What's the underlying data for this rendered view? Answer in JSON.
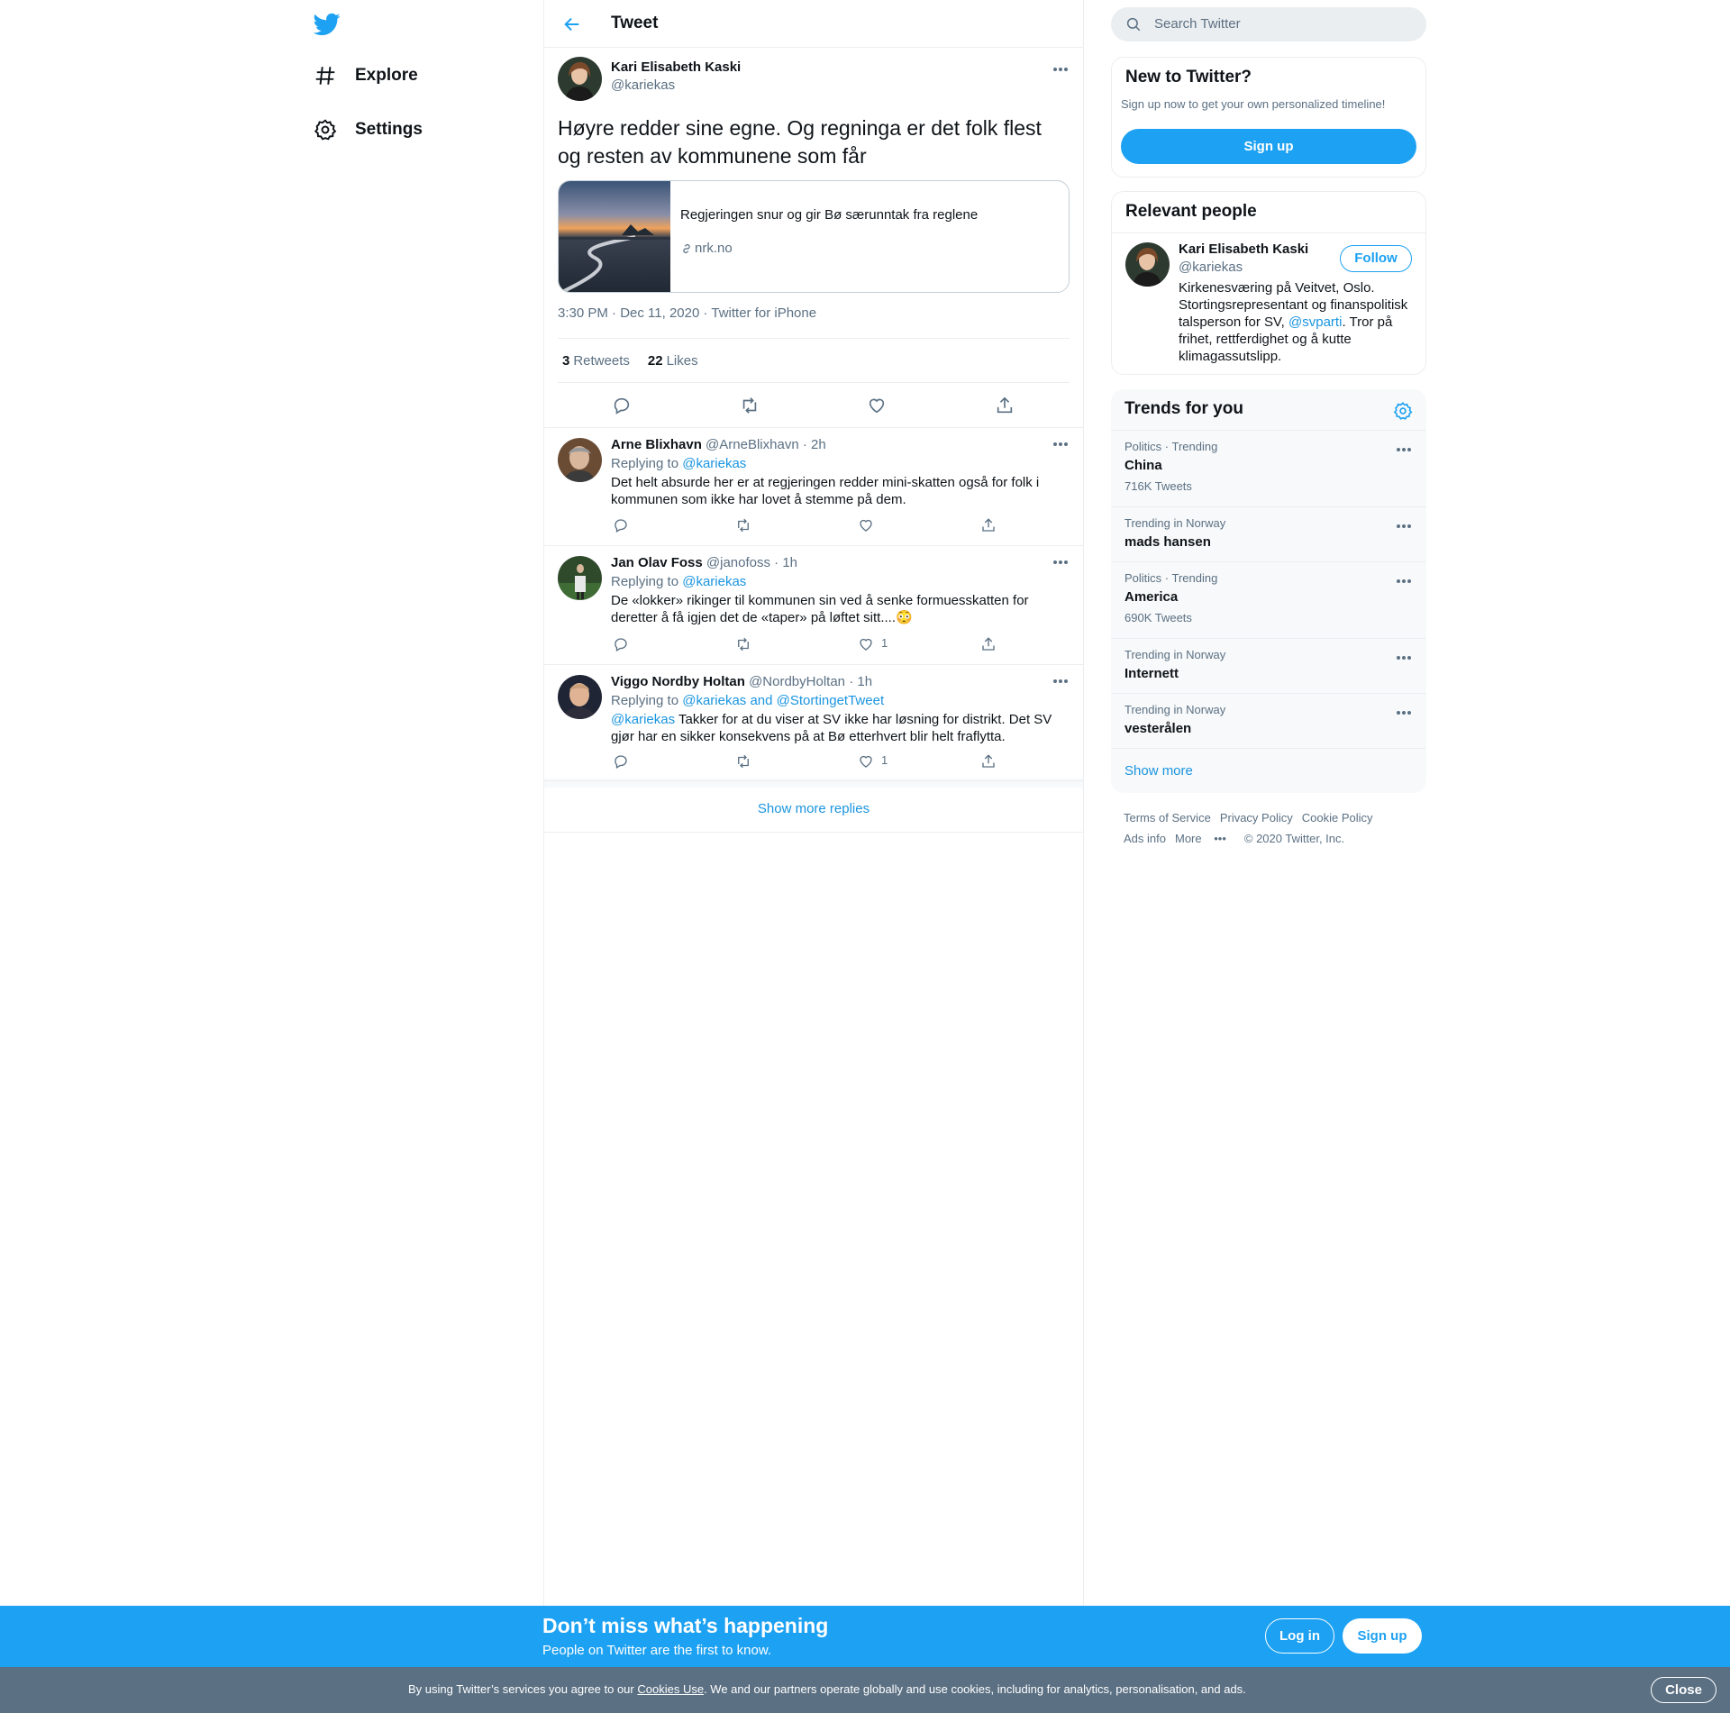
{
  "nav": {
    "logo_icon": "twitter-bird-icon",
    "items": [
      {
        "label": "Explore",
        "icon": "hashtag-icon"
      },
      {
        "label": "Settings",
        "icon": "gear-icon"
      }
    ]
  },
  "header": {
    "title": "Tweet",
    "back_icon": "back-arrow-icon"
  },
  "tweet": {
    "author_name": "Kari Elisabeth Kaski",
    "author_handle": "@kariekas",
    "text": "Høyre redder sine egne. Og regninga er det folk flest og resten av kommunene som får",
    "card": {
      "title": "Regjeringen snur og gir Bø særunntak fra reglene",
      "domain": "nrk.no"
    },
    "meta": "3:30 PM · Dec 11, 2020 · Twitter for iPhone",
    "retweets_count": "3",
    "retweets_label": "Retweets",
    "likes_count": "22",
    "likes_label": "Likes"
  },
  "replies": [
    {
      "name": "Arne Blixhavn",
      "handle": "@ArneBlixhavn",
      "time": "· 2h",
      "replying_prefix": "Replying to ",
      "replying_to": "@kariekas",
      "mention": "",
      "text": "Det helt absurde her er at regjeringen redder mini-skatten også for folk i kommunen som ikke har lovet å stemme på dem.",
      "likes": ""
    },
    {
      "name": "Jan Olav Foss",
      "handle": "@janofoss",
      "time": "· 1h",
      "replying_prefix": "Replying to ",
      "replying_to": "@kariekas",
      "mention": "",
      "text": "De «lokker» rikinger til kommunen sin ved å senke formuesskatten for deretter å få igjen det de «taper» på løftet sitt....😳",
      "likes": "1"
    },
    {
      "name": "Viggo Nordby Holtan",
      "handle": "@NordbyHoltan",
      "time": "· 1h",
      "replying_prefix": "Replying to ",
      "replying_to": "@kariekas and @StortingetTweet",
      "mention": "@kariekas",
      "text": " Takker for at du viser at SV ikke har løsning for distrikt. Det SV gjør har en sikker konsekvens på at Bø etterhvert blir helt fraflytta.",
      "likes": "1"
    }
  ],
  "show_more_replies": "Show more replies",
  "search": {
    "placeholder": "Search Twitter"
  },
  "new_to_twitter": {
    "title": "New to Twitter?",
    "subtitle": "Sign up now to get your own personalized timeline!",
    "button": "Sign up"
  },
  "relevant_people": {
    "title": "Relevant people",
    "name": "Kari Elisabeth Kaski",
    "handle": "@kariekas",
    "follow": "Follow",
    "bio_before": "Kirkenesværing på Veitvet, Oslo. Stortingsrepresentant og finanspolitisk talsperson for SV, ",
    "bio_link": "@svparti",
    "bio_after": ". Tror på frihet, rettferdighet og å kutte klimagassutslipp."
  },
  "trends": {
    "title": "Trends for you",
    "items": [
      {
        "context": "Politics · Trending",
        "name": "China",
        "count": "716K Tweets"
      },
      {
        "context": "Trending in Norway",
        "name": "mads hansen",
        "count": ""
      },
      {
        "context": "Politics · Trending",
        "name": "America",
        "count": "690K Tweets"
      },
      {
        "context": "Trending in Norway",
        "name": "Internett",
        "count": ""
      },
      {
        "context": "Trending in Norway",
        "name": "vesterålen",
        "count": ""
      }
    ],
    "show_more": "Show more"
  },
  "footer": {
    "links": [
      "Terms of Service",
      "Privacy Policy",
      "Cookie Policy",
      "Ads info",
      "More"
    ],
    "copyright": "© 2020 Twitter, Inc."
  },
  "bottom_bar": {
    "title": "Don’t miss what’s happening",
    "subtitle": "People on Twitter are the first to know.",
    "login": "Log in",
    "signup": "Sign up"
  },
  "cookie_bar": {
    "prefix": "By using Twitter’s services you agree to our ",
    "link": "Cookies Use",
    "suffix": ". We and our partners operate globally and use cookies, including for analytics, personalisation, and ads.",
    "close": "Close"
  },
  "colors": {
    "accent": "#1da1f2",
    "link": "#1b95e0",
    "muted": "#5b7083",
    "cookie_bg": "#5b7083"
  }
}
